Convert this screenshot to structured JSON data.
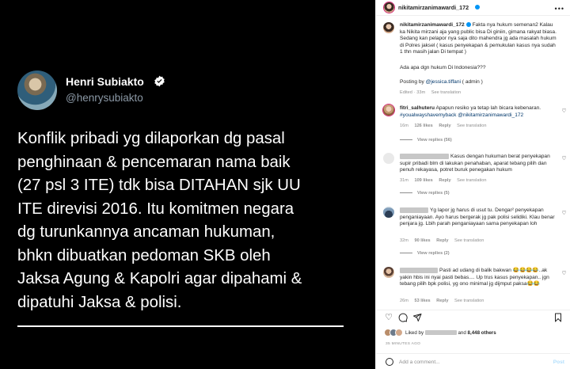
{
  "tweet": {
    "name": "Henri Subiakto",
    "handle": "@henrysubiakto",
    "lines": [
      "Konflik pribadi yg dilaporkan dg pasal",
      "penghinaan & pencemaran nama baik",
      "(27 psl 3 ITE) tdk bisa DITAHAN sjk UU",
      "ITE direvisi 2016. Itu komitmen negara",
      "dg turunkannya ancaman hukuman,",
      "bhkn dibuatkan pedoman SKB oleh",
      "Jaksa Agung & Kapolri agar dipahami &",
      "dipatuhi Jaksa & polisi."
    ]
  },
  "header": {
    "username": "nikitamirzanimawardi_172",
    "more": "•••"
  },
  "caption": {
    "username": "nikitamirzanimawardi_172",
    "text": "Fakta nya hukum semenan2 Kalau ka Nikita mirzani aja yang public bisa Di giniin, gimana rakyat biasa. Sedang kan pelapor nya saja dito mahendra jg ada masalah hukum di Polres jaksel ( kasus penyekapan & pemukulan kasus nya sudah 1 thn masih jalan Di tempat )",
    "line2": "Ada apa dgn hukum Di Indonesia???",
    "posting_prefix": "Posting by ",
    "posting_link": "@jessica.tiffani",
    "posting_suffix": " ( admin )",
    "edited": "Edited",
    "time": "33m",
    "see_translation": "See translation"
  },
  "comments": [
    {
      "username": "fitri_salhuteru",
      "text": "Apapun resiko ya tetap lah bicara kebenaran.",
      "link": "#youalwayshavemyback @nikitamirzanimawardi_172",
      "time": "16m",
      "likes": "126 likes",
      "reply": "Reply",
      "see_translation": "See translation",
      "view_replies": "View replies (56)"
    },
    {
      "text": "Kasus dengan hukuman berat penyekapan supir pribadi blm di lakukan penahaban, aparat tebang pilih dan penuh rekayasa, potret buruk penegakan hukum",
      "time": "31m",
      "likes": "109 likes",
      "reply": "Reply",
      "see_translation": "See translation",
      "view_replies": "View replies (5)"
    },
    {
      "text": "Yg lapor jg harus di usut tu. Dengar² penyekapan penganiayaan. Ayo harus bergerak jg pak polisi selidiki. Klau benar penjara jg. Lbih parah penganiayaan sama penyekapan loh",
      "time": "32m",
      "likes": "90 likes",
      "reply": "Reply",
      "see_translation": "See translation",
      "view_replies": "View replies (2)"
    },
    {
      "text": "Pasti ad udang di balik bakwan 😂😂😂😂..ak yakin hbis ini nyai pasti bebas.... Up trus kasus penyekapan.. jgn tebang pilih bpk polisi, yg ono minimal jg dijmput paksa😂😂",
      "time": "26m",
      "likes": "53 likes",
      "reply": "Reply",
      "see_translation": "See translation"
    }
  ],
  "liked_by": {
    "prefix": "Liked by ",
    "and": " and ",
    "others": "8,448 others"
  },
  "timestamp": "35 MINUTES AGO",
  "add_comment": {
    "placeholder": "Add a comment...",
    "post": "Post"
  },
  "colors": {
    "link": "#00376b",
    "accent": "#0095f6",
    "meta": "#8e8e8e"
  }
}
